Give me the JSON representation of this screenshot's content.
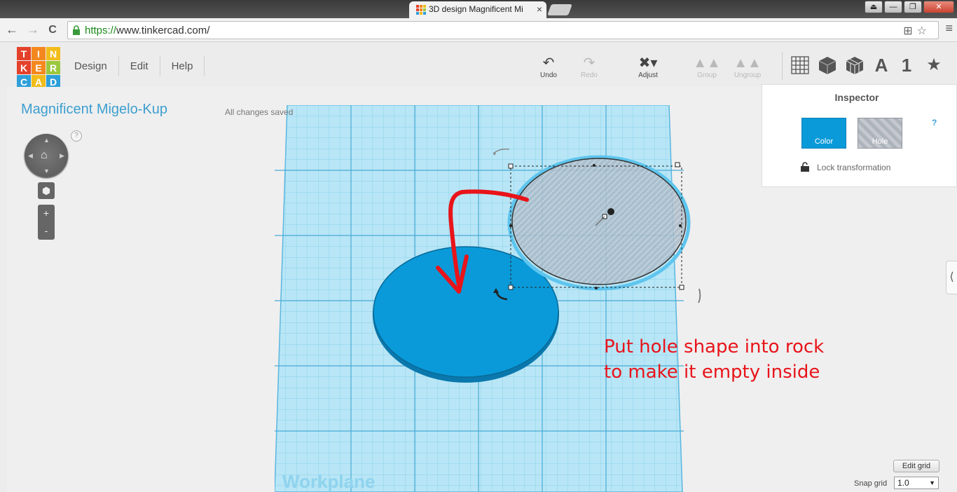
{
  "browser": {
    "tab_title": "3D design Magnificent Mi",
    "tab_close": "×",
    "url_scheme": "https://",
    "url_rest": "www.tinkercad.com/",
    "nav_back": "←",
    "nav_forward": "→",
    "nav_reload": "C",
    "right_icons": "⊞☆",
    "menu_icon": "≡",
    "window_buttons": [
      "⏏",
      "—",
      "❐",
      "✕"
    ]
  },
  "app": {
    "logo_letters": [
      "T",
      "I",
      "N",
      "K",
      "E",
      "R",
      "C",
      "A",
      "D"
    ],
    "logo_colors": [
      "#e4412b",
      "#f4881f",
      "#f2bc1a",
      "#e4412b",
      "#f4881f",
      "#9bc83d",
      "#2d9fd9",
      "#f2bc1a",
      "#2d9fd9"
    ],
    "menu": [
      "Design",
      "Edit",
      "Help"
    ],
    "toolbar": {
      "undo": "Undo",
      "redo": "Redo",
      "adjust": "Adjust",
      "group": "Group",
      "ungroup": "Ungroup"
    },
    "view_icons": [
      "grid-icon",
      "box-icon",
      "wireframe-box-icon",
      "text-A-icon",
      "number-1-icon",
      "star-icon"
    ],
    "view_icon_glyphs": {
      "text": "A",
      "number": "1",
      "star": "★"
    }
  },
  "project": {
    "title": "Magnificent Migelo-Kup",
    "save_status": "All changes saved",
    "help": "?"
  },
  "navigation": {
    "zoom_in": "+",
    "zoom_out": "-"
  },
  "workplane": {
    "label": "Workplane",
    "color": "#b8e6f6"
  },
  "inspector": {
    "title": "Inspector",
    "color_label": "Color",
    "hole_label": "Hole",
    "help": "?",
    "lock_text": "Lock transformation",
    "colors": {
      "solid": "#0a9ad9"
    }
  },
  "grid_controls": {
    "edit_grid": "Edit grid",
    "snap_label": "Snap grid",
    "snap_value": "1.0"
  },
  "annotation": {
    "line1": "Put hole shape into rock",
    "line2": "to make it empty inside",
    "color": "#e8141a"
  }
}
